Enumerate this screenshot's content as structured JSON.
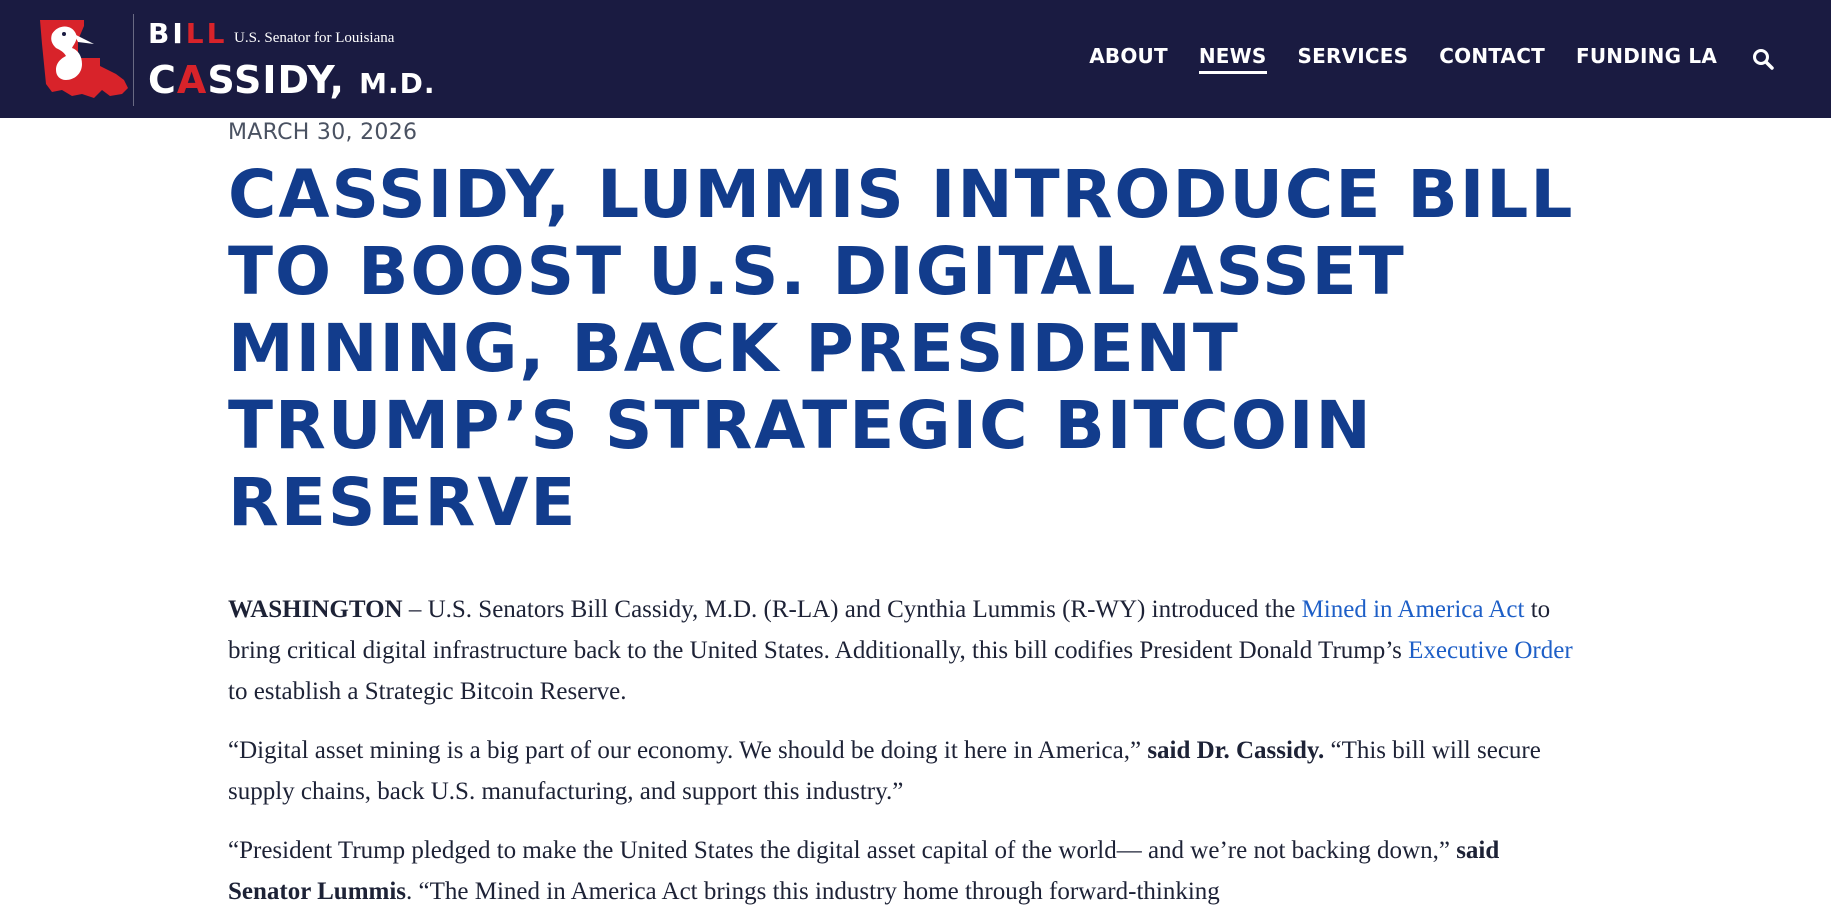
{
  "header": {
    "logo": {
      "first_name_part1": "BI",
      "first_name_red": "LL",
      "subtitle": "U.S. Senator for Louisiana",
      "last_name_part1": "C",
      "last_name_red": "A",
      "last_name_part2": "SSIDY,",
      "last_name_suffix": "M.D."
    },
    "nav": [
      {
        "label": "ABOUT",
        "active": false
      },
      {
        "label": "NEWS",
        "active": true
      },
      {
        "label": "SERVICES",
        "active": false
      },
      {
        "label": "CONTACT",
        "active": false
      },
      {
        "label": "FUNDING LA",
        "active": false
      }
    ],
    "search_icon": "search-icon"
  },
  "article": {
    "date": "MARCH 30, 2026",
    "title": "CASSIDY, LUMMIS INTRODUCE BILL TO BOOST U.S. DIGITAL ASSET MINING, BACK PRESIDENT TRUMP’S STRATEGIC BITCOIN RESERVE",
    "p1": {
      "dateline": "WASHINGTON",
      "text1": " – U.S. Senators Bill Cassidy, M.D. (R-LA) and Cynthia Lummis (R-WY) introduced the ",
      "link1": "Mined in America Act",
      "text2": " to bring critical digital infrastructure back to the United States. Additionally, this bill codifies President Donald Trump’s ",
      "link2": "Executive Order",
      "text3": " to establish a Strategic Bitcoin Reserve."
    },
    "p2": {
      "text1": "“Digital asset mining is a big part of our economy. We should be doing it here in America,” ",
      "attribution": "said Dr. Cassidy.",
      "text2": " “This bill will secure supply chains, back U.S. manufacturing, and support this industry.”"
    },
    "p3": {
      "text1": "“President Trump pledged to make the United States the digital asset capital of the world— and we’re not backing down,” ",
      "attribution": "said Senator Lummis",
      "text2": ". “The Mined in America Act brings this industry home through forward-thinking"
    }
  },
  "colors": {
    "header_bg": "#1a1b41",
    "title_blue": "#123c8c",
    "link_blue": "#1e5fc7",
    "brand_red": "#d8232a"
  }
}
